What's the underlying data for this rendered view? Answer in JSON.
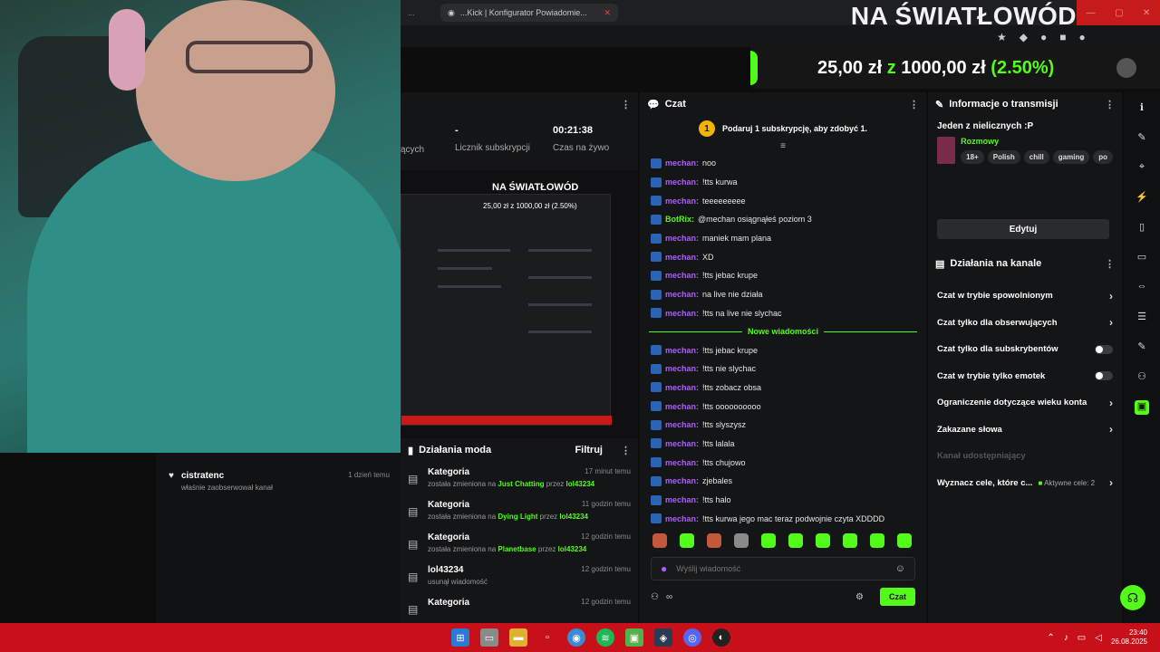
{
  "browser": {
    "prev_tab": "...",
    "active_tab": "...Kick | Konfigurator Powiadomie...",
    "tab_close": "✕"
  },
  "overlay": {
    "brand": "NA ŚWIATŁOWÓD",
    "goal_current": "25,00 zł",
    "goal_of": "z",
    "goal_target": "1000,00 zł",
    "goal_pct": "(2.50%)"
  },
  "stats": {
    "partial_label": "ących",
    "subs_value": "-",
    "subs_label": "Licznik subskrypcji",
    "live_value": "00:21:38",
    "live_label": "Czas na żywo"
  },
  "preview": {
    "title": "NA ŚWIATŁOWÓD",
    "goal": "25,00 zł z 1000,00 zł (2.50%)"
  },
  "mod_actions": {
    "title": "Działania moda",
    "filter": "Filtruj",
    "rows": [
      {
        "title": "Kategoria",
        "time": "17 minut temu",
        "pre": "została zmieniona na",
        "target": "Just Chatting",
        "mid": "przez",
        "by": "lol43234"
      },
      {
        "title": "Kategoria",
        "time": "11 godzin temu",
        "pre": "została zmieniona na",
        "target": "Dying Light",
        "mid": "przez",
        "by": "lol43234"
      },
      {
        "title": "Kategoria",
        "time": "12 godzin temu",
        "pre": "została zmieniona na",
        "target": "Planetbase",
        "mid": "przez",
        "by": "lol43234"
      },
      {
        "title": "lol43234",
        "time": "12 godzin temu",
        "pre": "usunął wiadomość",
        "target": "",
        "mid": "",
        "by": ""
      },
      {
        "title": "Kategoria",
        "time": "12 godzin temu",
        "pre": "",
        "target": "",
        "mid": "",
        "by": ""
      }
    ]
  },
  "follows": {
    "user": "cistratenc",
    "text": "właśnie zaobserwował kanał",
    "time": "1 dzień temu"
  },
  "chat": {
    "title": "Czat",
    "sub_prompt": "Podaruj 1 subskrypcję, aby zdobyć 1.",
    "sub_coin": "1",
    "messages_before": [
      {
        "user": "mechan",
        "text": "noo",
        "bot": false
      },
      {
        "user": "mechan",
        "text": "!tts kurwa",
        "bot": false
      },
      {
        "user": "mechan",
        "text": "teeeeeeeee",
        "bot": false
      },
      {
        "user": "BotRix",
        "text": "@mechan osiągnąłeś poziom 3",
        "bot": true
      },
      {
        "user": "mechan",
        "text": "maniek mam plana",
        "bot": false
      },
      {
        "user": "mechan",
        "text": "XD",
        "bot": false
      },
      {
        "user": "mechan",
        "text": "!tts jebac krupe",
        "bot": false
      },
      {
        "user": "mechan",
        "text": "na live nie działa",
        "bot": false
      },
      {
        "user": "mechan",
        "text": "!tts na live nie slychac",
        "bot": false
      }
    ],
    "new_messages_label": "Nowe wiadomości",
    "messages_after": [
      {
        "user": "mechan",
        "text": "!tts jebac krupe",
        "bot": false
      },
      {
        "user": "mechan",
        "text": "!tts nie slychac",
        "bot": false
      },
      {
        "user": "mechan",
        "text": "!tts zobacz obsa",
        "bot": false
      },
      {
        "user": "mechan",
        "text": "!tts oooooooooo",
        "bot": false
      },
      {
        "user": "mechan",
        "text": "!tts slyszysz",
        "bot": false
      },
      {
        "user": "mechan",
        "text": "!tts lalala",
        "bot": false
      },
      {
        "user": "mechan",
        "text": "!tts chujowo",
        "bot": false
      },
      {
        "user": "mechan",
        "text": "zjebales",
        "bot": false
      },
      {
        "user": "mechan",
        "text": "!tts halo",
        "bot": false
      },
      {
        "user": "mechan",
        "text": "!tts kurwa jego mac teraz podwojnie czyta XDDDD",
        "bot": false
      }
    ],
    "input_placeholder": "Wyślij wiadomość",
    "send": "Czat"
  },
  "stream_info": {
    "title": "Informacje o transmisji",
    "stream_title": "Jeden z nielicznych :P",
    "category": "Rozmowy",
    "tags": [
      "18+",
      "Polish",
      "chill",
      "gaming",
      "po"
    ],
    "edit": "Edytuj"
  },
  "channel_actions": {
    "title": "Działania na kanale",
    "slow_mode": "Czat w trybie spowolnionym",
    "followers_only": "Czat tylko dla obserwujących",
    "subs_only": "Czat tylko dla subskrybentów",
    "emotes_only": "Czat w trybie tylko emotek",
    "age_limit": "Ograniczenie dotyczące wieku konta",
    "banned_words": "Zakazane słowa",
    "host_channel": "Kanał udostępniający",
    "goals": "Wyznacz cele, które c...",
    "active_goals": "Aktywne cele: 2"
  },
  "taskbar": {
    "time": "23:40",
    "date": "26.08.2025"
  },
  "colors": {
    "accent": "#53fc18",
    "taskbar": "#c8101b",
    "username": "#b15bff"
  }
}
